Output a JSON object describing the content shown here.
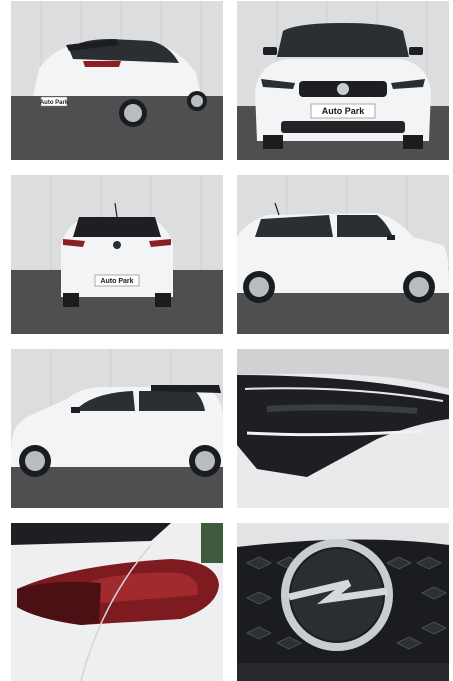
{
  "gallery": {
    "plate_text": "Auto Park",
    "colors": {
      "car_body": "#f2f3f4",
      "wall": "#dcdddf",
      "floor": "#4a4c4e",
      "glass": "#2a2d31",
      "taillight": "#8c1f24",
      "chrome": "#c9ccd0"
    },
    "photos": [
      {
        "view": "rear-three-quarter"
      },
      {
        "view": "front"
      },
      {
        "view": "rear"
      },
      {
        "view": "side-right"
      },
      {
        "view": "side-left"
      },
      {
        "view": "headlight-detail"
      },
      {
        "view": "taillight-detail"
      },
      {
        "view": "logo-detail"
      }
    ]
  }
}
